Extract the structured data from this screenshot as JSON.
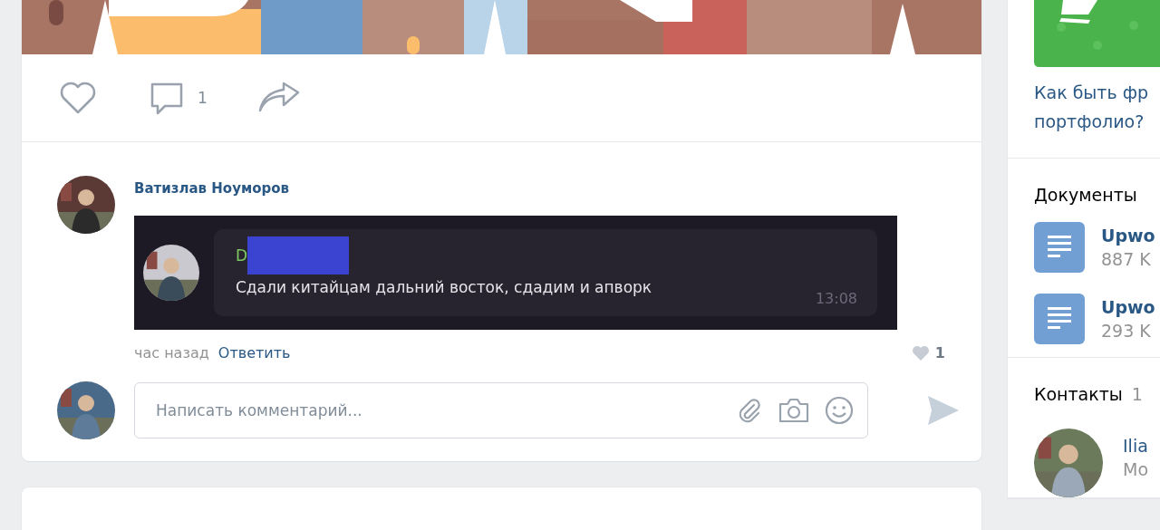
{
  "post": {
    "comments_count": "1"
  },
  "comment": {
    "author": "Ватизлав Ноуморов",
    "attachment": {
      "sender": "D",
      "message": "Сдали китайцам дальний восток, сдадим и апворк",
      "time": "13:08"
    },
    "time": "час назад",
    "reply": "Ответить",
    "likes": "1"
  },
  "composer": {
    "placeholder": "Написать комментарий..."
  },
  "sidebar": {
    "promo_link": [
      "Как быть фр",
      "портфолио?"
    ],
    "documents": {
      "title": "Документы",
      "items": [
        {
          "name": "Upwo",
          "size": "887 K"
        },
        {
          "name": "Upwo",
          "size": "293 K"
        }
      ]
    },
    "contacts": {
      "title": "Контакты",
      "count": "1",
      "items": [
        {
          "name": "Ilia",
          "subtitle": "Мо"
        }
      ]
    }
  }
}
